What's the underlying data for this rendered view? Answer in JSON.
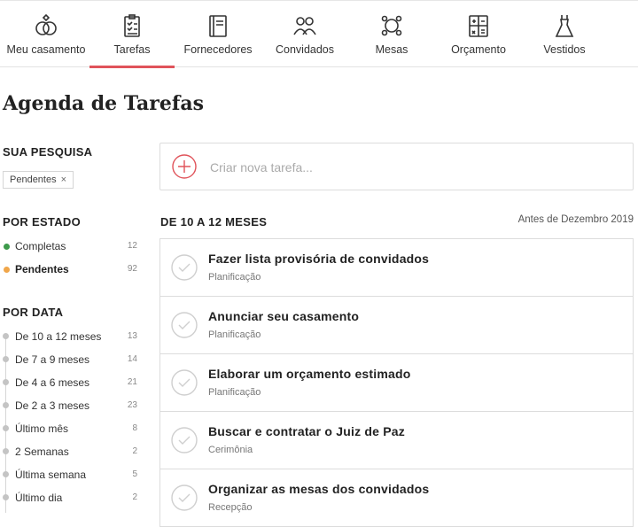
{
  "nav": {
    "items": [
      {
        "label": "Meu casamento",
        "icon": "rings-icon"
      },
      {
        "label": "Tarefas",
        "icon": "clipboard-icon"
      },
      {
        "label": "Fornecedores",
        "icon": "notebook-icon"
      },
      {
        "label": "Convidados",
        "icon": "guests-icon"
      },
      {
        "label": "Mesas",
        "icon": "table-icon"
      },
      {
        "label": "Orçamento",
        "icon": "calculator-icon"
      },
      {
        "label": "Vestidos",
        "icon": "dress-icon"
      }
    ],
    "active": "Tarefas",
    "accent_color": "#e0535a"
  },
  "page": {
    "title": "Agenda de Tarefas"
  },
  "sidebar": {
    "search": {
      "heading": "SUA PESQUISA",
      "chip_label": "Pendentes",
      "chip_close": "×"
    },
    "by_state": {
      "heading": "POR ESTADO",
      "items": [
        {
          "label": "Completas",
          "count": "12",
          "color": "#3d9a4b"
        },
        {
          "label": "Pendentes",
          "count": "92",
          "color": "#f0a64a"
        }
      ]
    },
    "by_date": {
      "heading": "POR DATA",
      "items": [
        {
          "label": "De 10 a 12 meses",
          "count": "13"
        },
        {
          "label": "De 7 a 9 meses",
          "count": "14"
        },
        {
          "label": "De 4 a 6 meses",
          "count": "21"
        },
        {
          "label": "De 2 a 3 meses",
          "count": "23"
        },
        {
          "label": "Último mês",
          "count": "8"
        },
        {
          "label": "2 Semanas",
          "count": "2"
        },
        {
          "label": "Última semana",
          "count": "5"
        },
        {
          "label": "Último dia",
          "count": "2"
        }
      ]
    }
  },
  "main": {
    "new_task": {
      "placeholder": "Criar nova tarefa..."
    },
    "group": {
      "title": "DE 10 A 12 MESES",
      "date": "Antes de Dezembro 2019"
    },
    "tasks": [
      {
        "title": "Fazer lista provisória de convidados",
        "category": "Planificação"
      },
      {
        "title": "Anunciar seu casamento",
        "category": "Planificação"
      },
      {
        "title": "Elaborar um orçamento estimado",
        "category": "Planificação"
      },
      {
        "title": "Buscar e contratar o Juiz de Paz",
        "category": "Cerimônia"
      },
      {
        "title": "Organizar as mesas dos convidados",
        "category": "Recepção"
      }
    ]
  }
}
